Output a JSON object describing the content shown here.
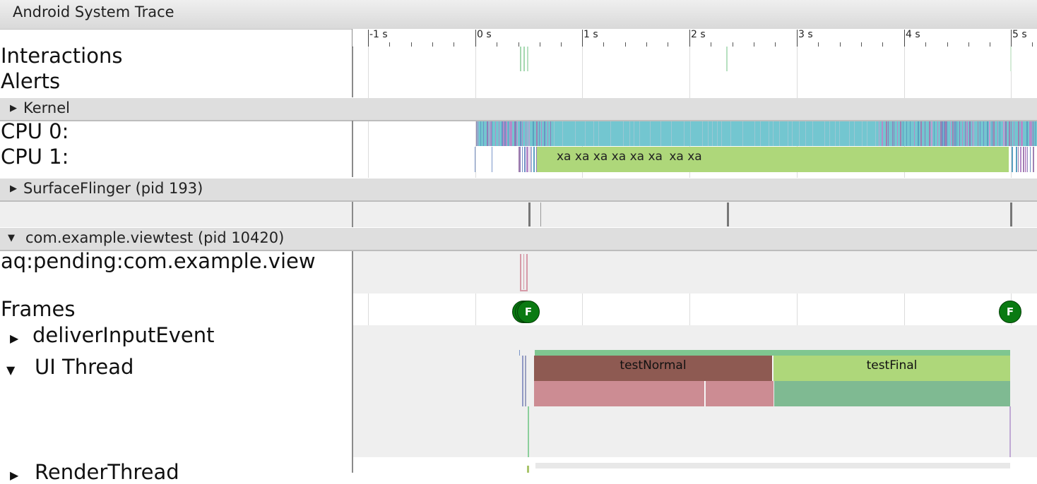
{
  "window": {
    "title": "Android System Trace"
  },
  "ruler": {
    "ticks": [
      "-1 s",
      "0 s",
      "1 s",
      "2 s",
      "3 s",
      "4 s",
      "5 s"
    ]
  },
  "tracks": {
    "interactions": "Interactions",
    "alerts": "Alerts",
    "cpu0": "CPU 0:",
    "cpu1": "CPU 1:",
    "aq_pending": "aq:pending:com.example.view",
    "frames": "Frames",
    "deliver_input": "deliverInputEvent",
    "ui_thread": "UI Thread",
    "render_thread_partial": "RenderThread"
  },
  "groups": {
    "kernel": "Kernel",
    "surfaceflinger": "SurfaceFlinger (pid 193)",
    "app": "com.example.viewtest (pid 10420)"
  },
  "cpu1_slices": [
    "xa",
    "xa",
    "xa",
    "xa",
    "xa",
    "xa",
    "xa",
    "xa"
  ],
  "ui_thread_slices": {
    "first": "testNormal",
    "second": "testFinal"
  },
  "frame_marker_label": "F",
  "colors": {
    "cpu_cyan": "#73c6d0",
    "cpu_green": "#aed77a",
    "test_normal": "#8e5a52",
    "test_final": "#aed77a",
    "pink": "#cc8c93",
    "teal_green": "#7fba92",
    "frame_green": "#0a7a12"
  }
}
